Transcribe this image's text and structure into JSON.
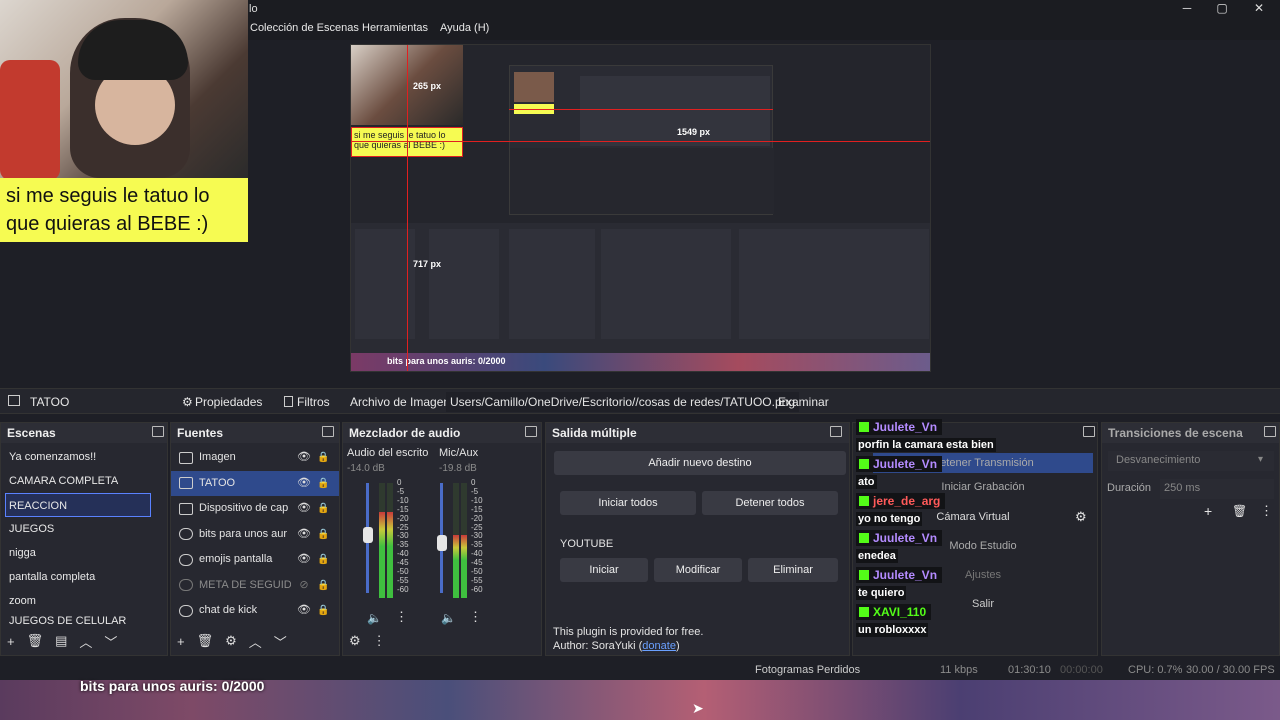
{
  "title_bar": {
    "title": "lo"
  },
  "menu": [
    "Colección de Escenas",
    "Herramientas",
    "Ayuda (H)"
  ],
  "window_controls": [
    "─",
    "▢",
    "✕"
  ],
  "webcam": {
    "caption": "si me seguis le tatuo lo que quieras al BEBE :)"
  },
  "preview": {
    "dim_labels": [
      "265 px",
      "1549 px",
      "717 px"
    ],
    "caption": "si me seguis le tatuo lo que quieras al BEBE :)",
    "bottom_text": "bits para unos auris: 0/2000"
  },
  "scene_bar": {
    "scene": "TATOO",
    "properties": "Propiedades",
    "filters": "Filtros",
    "image_label": "Archivo de Imagen",
    "path": "Users/Camillo/OneDrive/Escritorio//cosas de redes/TATUOO.png",
    "browse": "Examinar"
  },
  "scenes": {
    "title": "Escenas",
    "items": [
      "Ya comenzamos!!",
      "CAMARA COMPLETA",
      "REACCION",
      "JUEGOS",
      "nigga",
      "pantalla completa",
      "zoom",
      "JUEGOS DE CELULAR"
    ],
    "selected": 2
  },
  "sources": {
    "title": "Fuentes",
    "items": [
      {
        "name": "Imagen",
        "icon": "image-icon"
      },
      {
        "name": "TATOO",
        "icon": "image-icon"
      },
      {
        "name": "Dispositivo de cap",
        "icon": "camera-icon"
      },
      {
        "name": "bits para unos aur",
        "icon": "globe-icon"
      },
      {
        "name": "emojis pantalla",
        "icon": "globe-icon"
      },
      {
        "name": "META DE SEGUIDC",
        "icon": "globe-icon"
      },
      {
        "name": "chat de kick",
        "icon": "globe-icon"
      }
    ]
  },
  "mixer": {
    "title": "Mezclador de audio",
    "channels": [
      {
        "name": "Audio del escrito",
        "db": "-14.0 dB",
        "level": 0.75
      },
      {
        "name": "Mic/Aux",
        "db": "-19.8 dB",
        "level": 0.55
      }
    ],
    "scale": [
      "0",
      "-5",
      "-10",
      "-15",
      "-20",
      "-25",
      "-30",
      "-35",
      "-40",
      "-45",
      "-50",
      "-55",
      "-60"
    ]
  },
  "multi_output": {
    "title": "Salida múltiple",
    "add": "Añadir nuevo destino",
    "start_all": "Iniciar todos",
    "stop_all": "Detener todos",
    "target": "YOUTUBE",
    "start": "Iniciar",
    "modify": "Modificar",
    "delete": "Eliminar",
    "note1": "This plugin is provided for free.",
    "note2": "Author: SoraYuki",
    "donate": "donate"
  },
  "controls": {
    "items": [
      "Detener Transmisión",
      "Iniciar Grabación",
      "Cámara Virtual",
      "Modo Estudio",
      "Ajustes",
      "Salir"
    ]
  },
  "transitions": {
    "title": "Transiciones de escena",
    "type": "Desvanecimiento",
    "duration_label": "Duración",
    "duration": "250 ms"
  },
  "chat": [
    {
      "user": "Juulete_Vn",
      "msg": "porfin la camara esta bien",
      "color": "#b48bff"
    },
    {
      "user": "Juulete_Vn",
      "msg": "ato",
      "color": "#b48bff"
    },
    {
      "user": "jere_de_arg",
      "msg": "yo no tengo",
      "color": "#ff5a5a"
    },
    {
      "user": "Juulete_Vn",
      "msg": "enedea",
      "color": "#b48bff"
    },
    {
      "user": "Juulete_Vn",
      "msg": "te quiero",
      "color": "#b48bff"
    },
    {
      "user": "XAVI_110",
      "msg": "un robloxxxx",
      "color": "#53fc18"
    }
  ],
  "status": {
    "dropped": "Fotogramas Perdidos",
    "kbps": "11 kbps",
    "live_time": "01:30:10",
    "rec_time": "00:00:00",
    "cpu": "CPU: 0.7%",
    "fps": "30.00 / 30.00 FPS"
  },
  "overlay": {
    "bits": "bits para unos auris:  0/2000"
  }
}
